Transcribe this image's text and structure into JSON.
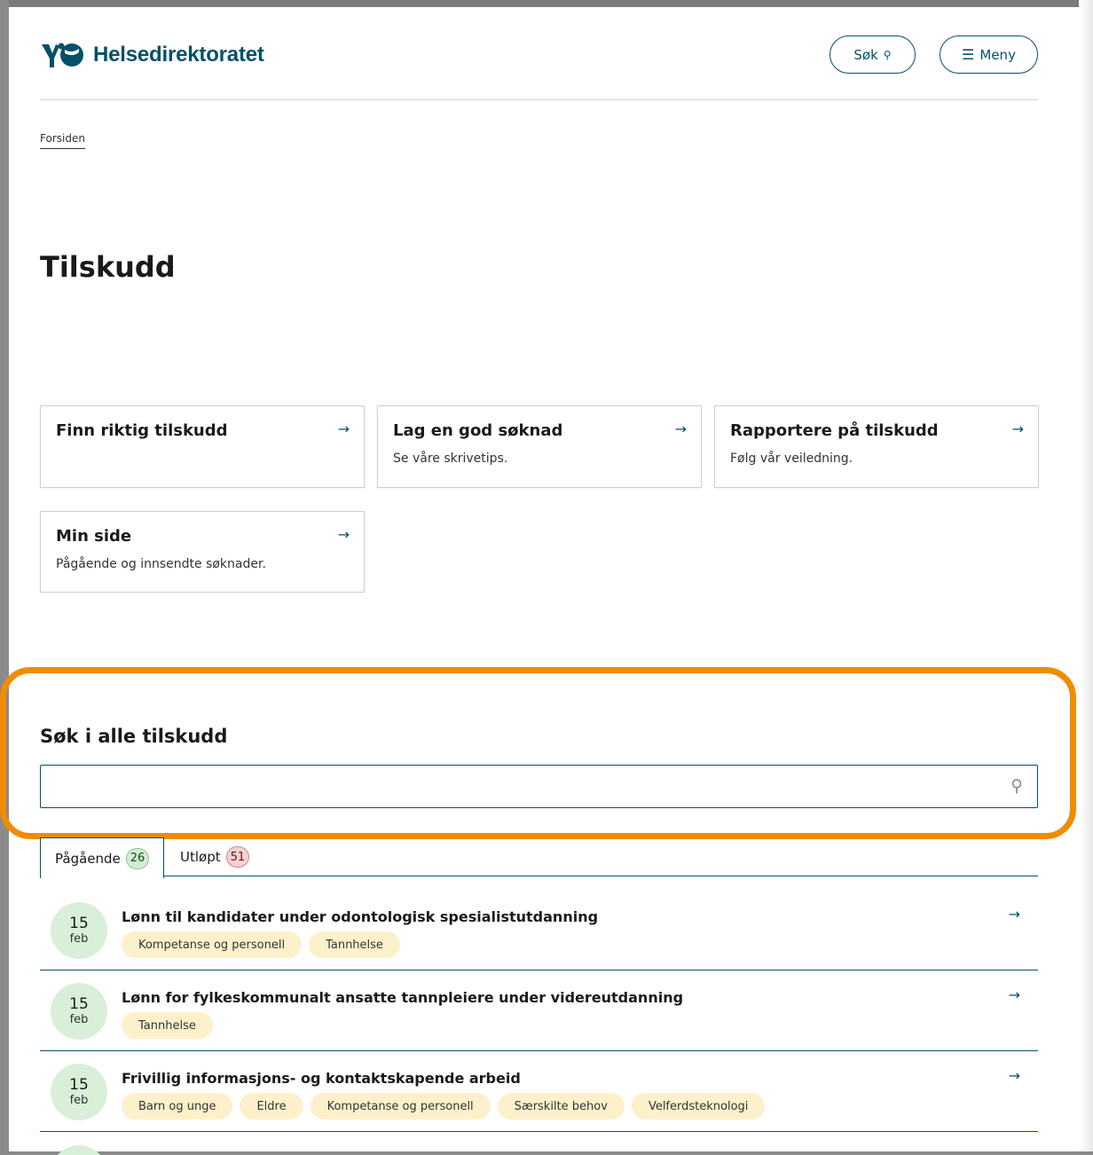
{
  "header": {
    "logo_text": "Helsedirektoratet",
    "search_label": "Søk",
    "menu_label": "Meny"
  },
  "breadcrumb": "Forsiden",
  "title": "Tilskudd",
  "cards": [
    {
      "title": "Finn riktig tilskudd",
      "sub": ""
    },
    {
      "title": "Lag en god søknad",
      "sub": "Se våre skrivetips."
    },
    {
      "title": "Rapportere på tilskudd",
      "sub": "Følg vår veiledning."
    },
    {
      "title": "Min side",
      "sub": "Pågående og innsendte søknader."
    }
  ],
  "search": {
    "heading": "Søk i alle tilskudd",
    "value": ""
  },
  "tabs": [
    {
      "label": "Pågående",
      "count": "26"
    },
    {
      "label": "Utløpt",
      "count": "51"
    }
  ],
  "items": [
    {
      "day": "15",
      "month": "feb",
      "title": "Lønn til kandidater under odontologisk spesialistutdanning",
      "tags": [
        "Kompetanse og personell",
        "Tannhelse"
      ]
    },
    {
      "day": "15",
      "month": "feb",
      "title": "Lønn for fylkeskommunalt ansatte tannpleiere under videreutdanning",
      "tags": [
        "Tannhelse"
      ]
    },
    {
      "day": "15",
      "month": "feb",
      "title": "Frivillig informasjons- og kontaktskapende arbeid",
      "tags": [
        "Barn og unge",
        "Eldre",
        "Kompetanse og personell",
        "Særskilte behov",
        "Velferdsteknologi"
      ]
    }
  ],
  "colors": {
    "brand": "#025169",
    "highlight": "#f08c00",
    "tag": "#fdf1cc",
    "date_circle": "#d8efd8"
  }
}
